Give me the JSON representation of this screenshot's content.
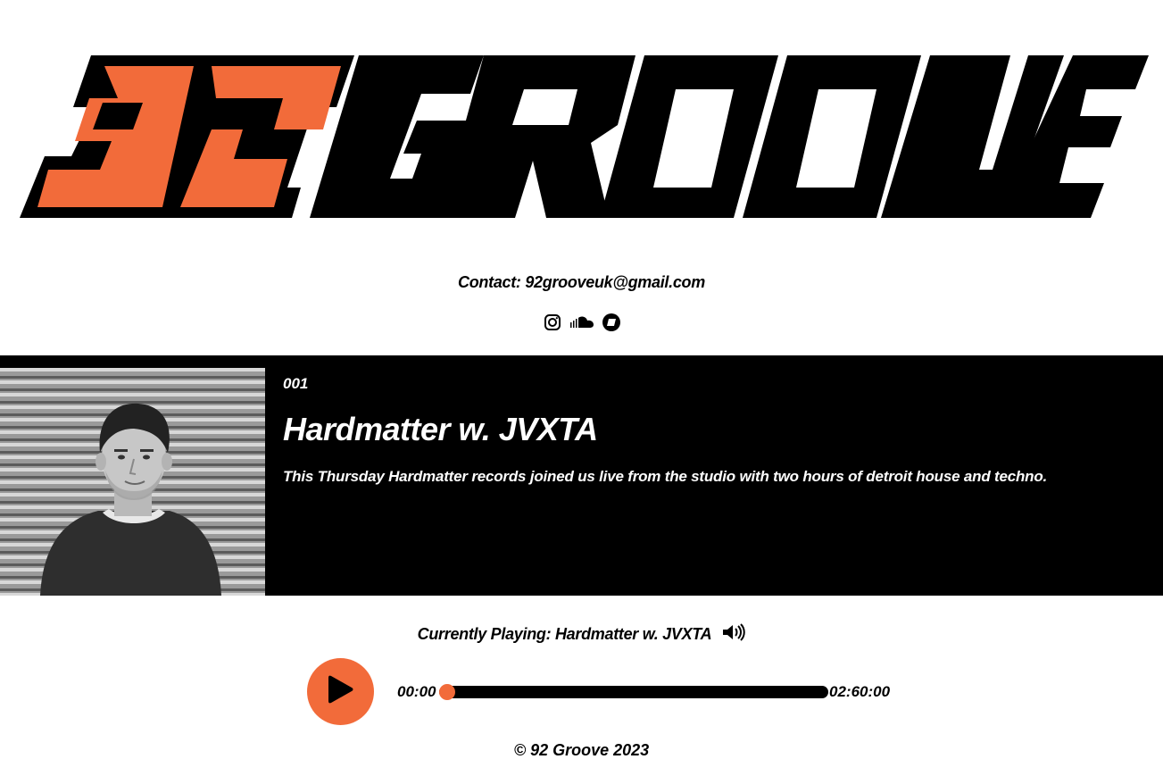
{
  "brand": {
    "logo_number": "92",
    "logo_word": "GROOVE",
    "accent": "#f26b3a"
  },
  "contact": {
    "text": "Contact: 92grooveuk@gmail.com"
  },
  "social": {
    "icons": [
      "instagram-icon",
      "soundcloud-icon",
      "bandcamp-icon"
    ]
  },
  "episode": {
    "number": "001",
    "title": "Hardmatter w. JVXTA",
    "description": "This Thursday Hardmatter records joined us live from the studio with two hours of detroit house and techno."
  },
  "player": {
    "now_playing": "Currently Playing: Hardmatter w. JVXTA",
    "current_time": "00:00",
    "total_time": "02:60:00",
    "progress": 0
  },
  "footer": {
    "text": "© 92 Groove 2023"
  }
}
